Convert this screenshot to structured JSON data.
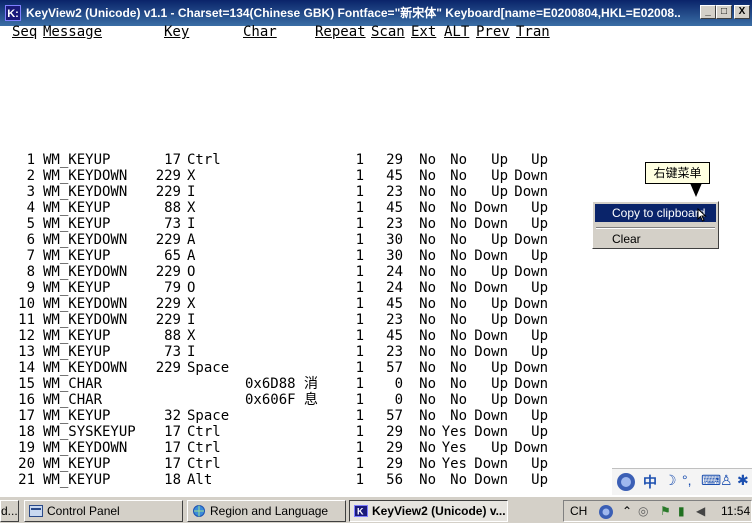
{
  "window": {
    "app_icon": "K:",
    "title": "KeyView2 (Unicode) v1.1 - Charset=134(Chinese GBK) Fontface=\"新宋体\" Keyboard[name=E0200804,HKL=E02008...",
    "minimize": "_",
    "maximize": "□",
    "close": "X"
  },
  "columns": [
    "Seq",
    "Message",
    "Key",
    "Char",
    "Repeat",
    "Scan",
    "Ext",
    "ALT",
    "Prev",
    "Tran"
  ],
  "rows": [
    {
      "seq": "1",
      "msg": "WM_KEYUP",
      "key": "17",
      "keyname": "Ctrl",
      "char": "",
      "repeat": "1",
      "scan": "29",
      "ext": "No",
      "alt": "No",
      "prev": "Up",
      "tran": "Up"
    },
    {
      "seq": "2",
      "msg": "WM_KEYDOWN",
      "key": "229",
      "keyname": "X",
      "char": "",
      "repeat": "1",
      "scan": "45",
      "ext": "No",
      "alt": "No",
      "prev": "Up",
      "tran": "Down"
    },
    {
      "seq": "3",
      "msg": "WM_KEYDOWN",
      "key": "229",
      "keyname": "I",
      "char": "",
      "repeat": "1",
      "scan": "23",
      "ext": "No",
      "alt": "No",
      "prev": "Up",
      "tran": "Down"
    },
    {
      "seq": "4",
      "msg": "WM_KEYUP",
      "key": "88",
      "keyname": "X",
      "char": "",
      "repeat": "1",
      "scan": "45",
      "ext": "No",
      "alt": "No",
      "prev": "Down",
      "tran": "Up"
    },
    {
      "seq": "5",
      "msg": "WM_KEYUP",
      "key": "73",
      "keyname": "I",
      "char": "",
      "repeat": "1",
      "scan": "23",
      "ext": "No",
      "alt": "No",
      "prev": "Down",
      "tran": "Up"
    },
    {
      "seq": "6",
      "msg": "WM_KEYDOWN",
      "key": "229",
      "keyname": "A",
      "char": "",
      "repeat": "1",
      "scan": "30",
      "ext": "No",
      "alt": "No",
      "prev": "Up",
      "tran": "Down"
    },
    {
      "seq": "7",
      "msg": "WM_KEYUP",
      "key": "65",
      "keyname": "A",
      "char": "",
      "repeat": "1",
      "scan": "30",
      "ext": "No",
      "alt": "No",
      "prev": "Down",
      "tran": "Up"
    },
    {
      "seq": "8",
      "msg": "WM_KEYDOWN",
      "key": "229",
      "keyname": "O",
      "char": "",
      "repeat": "1",
      "scan": "24",
      "ext": "No",
      "alt": "No",
      "prev": "Up",
      "tran": "Down"
    },
    {
      "seq": "9",
      "msg": "WM_KEYUP",
      "key": "79",
      "keyname": "O",
      "char": "",
      "repeat": "1",
      "scan": "24",
      "ext": "No",
      "alt": "No",
      "prev": "Down",
      "tran": "Up"
    },
    {
      "seq": "10",
      "msg": "WM_KEYDOWN",
      "key": "229",
      "keyname": "X",
      "char": "",
      "repeat": "1",
      "scan": "45",
      "ext": "No",
      "alt": "No",
      "prev": "Up",
      "tran": "Down"
    },
    {
      "seq": "11",
      "msg": "WM_KEYDOWN",
      "key": "229",
      "keyname": "I",
      "char": "",
      "repeat": "1",
      "scan": "23",
      "ext": "No",
      "alt": "No",
      "prev": "Up",
      "tran": "Down"
    },
    {
      "seq": "12",
      "msg": "WM_KEYUP",
      "key": "88",
      "keyname": "X",
      "char": "",
      "repeat": "1",
      "scan": "45",
      "ext": "No",
      "alt": "No",
      "prev": "Down",
      "tran": "Up"
    },
    {
      "seq": "13",
      "msg": "WM_KEYUP",
      "key": "73",
      "keyname": "I",
      "char": "",
      "repeat": "1",
      "scan": "23",
      "ext": "No",
      "alt": "No",
      "prev": "Down",
      "tran": "Up"
    },
    {
      "seq": "14",
      "msg": "WM_KEYDOWN",
      "key": "229",
      "keyname": "Space",
      "char": "",
      "repeat": "1",
      "scan": "57",
      "ext": "No",
      "alt": "No",
      "prev": "Up",
      "tran": "Down"
    },
    {
      "seq": "15",
      "msg": "WM_CHAR",
      "key": "",
      "keyname": "",
      "char": "0x6D88 消",
      "repeat": "1",
      "scan": "0",
      "ext": "No",
      "alt": "No",
      "prev": "Up",
      "tran": "Down"
    },
    {
      "seq": "16",
      "msg": "WM_CHAR",
      "key": "",
      "keyname": "",
      "char": "0x606F 息",
      "repeat": "1",
      "scan": "0",
      "ext": "No",
      "alt": "No",
      "prev": "Up",
      "tran": "Down"
    },
    {
      "seq": "17",
      "msg": "WM_KEYUP",
      "key": "32",
      "keyname": "Space",
      "char": "",
      "repeat": "1",
      "scan": "57",
      "ext": "No",
      "alt": "No",
      "prev": "Down",
      "tran": "Up"
    },
    {
      "seq": "18",
      "msg": "WM_SYSKEYUP",
      "key": "17",
      "keyname": "Ctrl",
      "char": "",
      "repeat": "1",
      "scan": "29",
      "ext": "No",
      "alt": "Yes",
      "prev": "Down",
      "tran": "Up"
    },
    {
      "seq": "19",
      "msg": "WM_KEYDOWN",
      "key": "17",
      "keyname": "Ctrl",
      "char": "",
      "repeat": "1",
      "scan": "29",
      "ext": "No",
      "alt": "Yes",
      "prev": "Up",
      "tran": "Down"
    },
    {
      "seq": "20",
      "msg": "WM_KEYUP",
      "key": "17",
      "keyname": "Ctrl",
      "char": "",
      "repeat": "1",
      "scan": "29",
      "ext": "No",
      "alt": "Yes",
      "prev": "Down",
      "tran": "Up"
    },
    {
      "seq": "21",
      "msg": "WM_KEYUP",
      "key": "18",
      "keyname": "Alt",
      "char": "",
      "repeat": "1",
      "scan": "56",
      "ext": "No",
      "alt": "No",
      "prev": "Down",
      "tran": "Up"
    }
  ],
  "tooltip": {
    "text": "右键菜单"
  },
  "context_menu": {
    "items": [
      "Copy to clipboard",
      "Clear"
    ],
    "selected": "Copy to clipboard"
  },
  "ime_bar": {
    "icons": [
      "ime-logo-icon",
      "中",
      "moon-icon",
      "punctuation-icon",
      "keyboard-icon",
      "person-icon",
      "settings-icon"
    ],
    "mode": "中"
  },
  "taskbar": {
    "tasks": [
      {
        "label": "d...",
        "icon": "generic-window-icon",
        "active": false
      },
      {
        "label": "Control Panel",
        "icon": "control-panel-icon",
        "active": false
      },
      {
        "label": "Region and Language",
        "icon": "globe-icon",
        "active": false
      },
      {
        "label": "KeyView2 (Unicode) v...",
        "icon": "keyview-icon",
        "active": true
      }
    ],
    "tray": {
      "lang": "CH",
      "clock": "11:54"
    }
  }
}
